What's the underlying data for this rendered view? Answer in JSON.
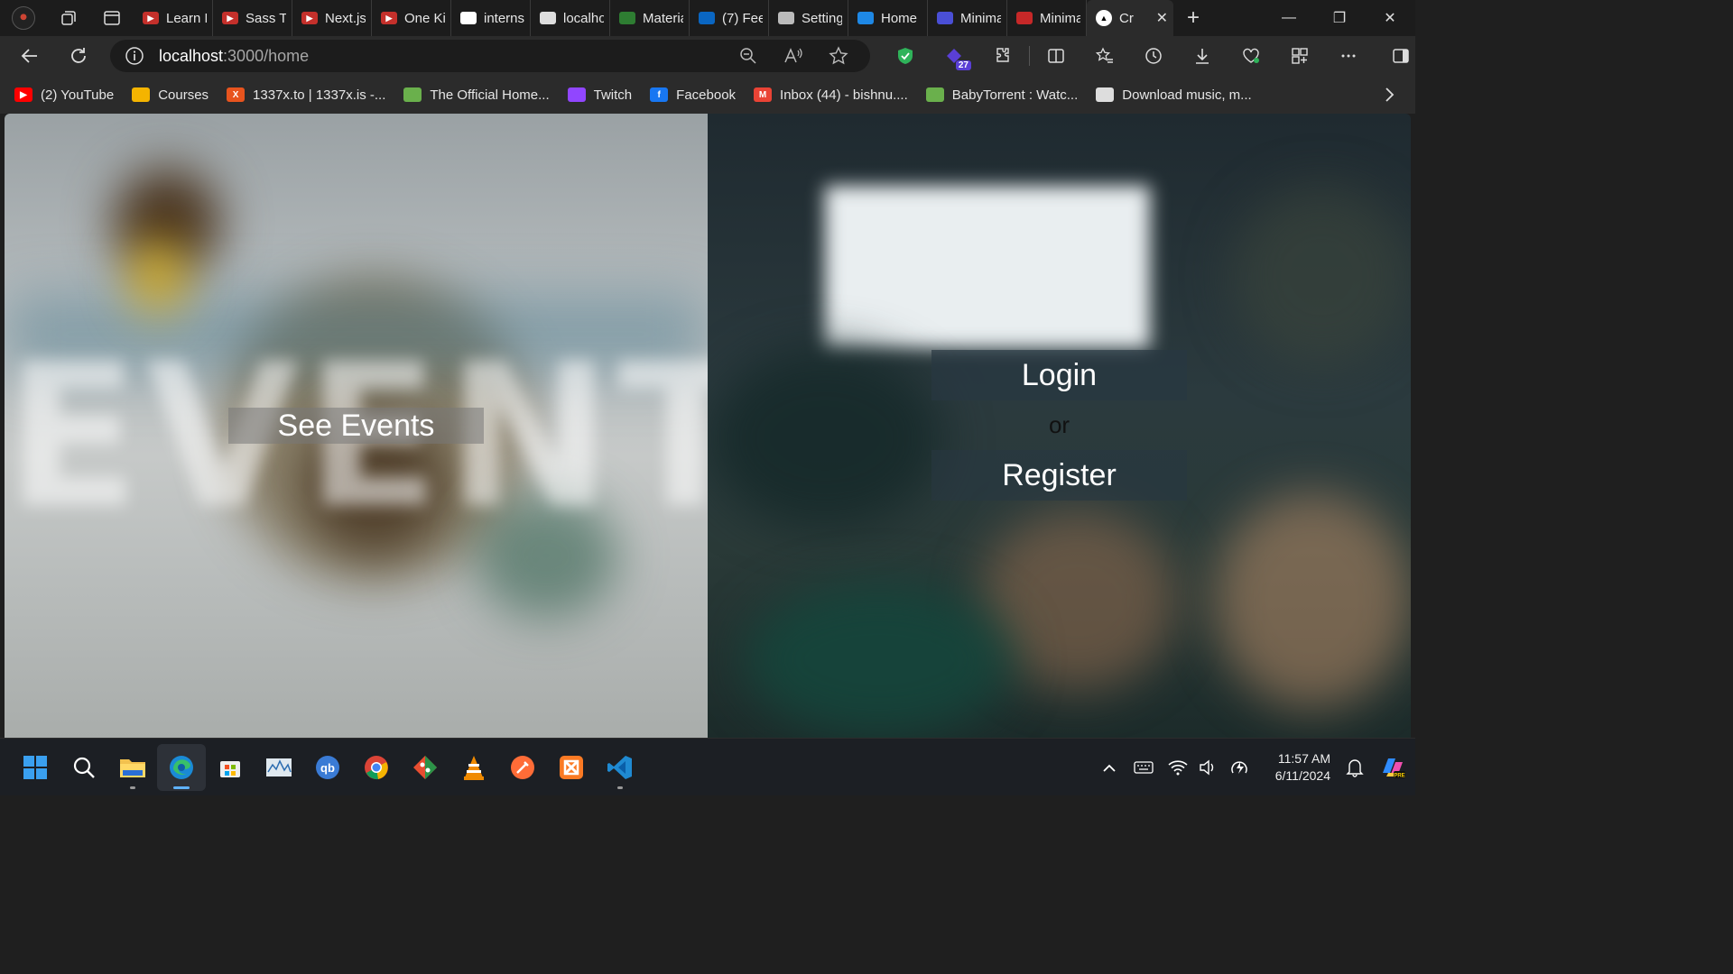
{
  "tabs": [
    {
      "label": "Learn R",
      "icon": "youtube-icon",
      "color": "#c4302b"
    },
    {
      "label": "Sass Tu",
      "icon": "youtube-icon",
      "color": "#c4302b"
    },
    {
      "label": "Next.js",
      "icon": "youtube-icon",
      "color": "#c4302b"
    },
    {
      "label": "One Ki",
      "icon": "youtube-icon",
      "color": "#c4302b"
    },
    {
      "label": "interns",
      "icon": "github-icon",
      "color": "#ffffff"
    },
    {
      "label": "localho",
      "icon": "document-icon",
      "color": "#dddddd"
    },
    {
      "label": "Materia",
      "icon": "material-icon",
      "color": "#2e7d32"
    },
    {
      "label": "(7) Fee",
      "icon": "linkedin-icon",
      "color": "#0a66c2"
    },
    {
      "label": "Setting",
      "icon": "gear-icon",
      "color": "#bbbbbb"
    },
    {
      "label": "Home",
      "icon": "c-logo-icon",
      "color": "#1e88e5"
    },
    {
      "label": "Minima",
      "icon": "app-icon",
      "color": "#4a4fd6"
    },
    {
      "label": "Minima",
      "icon": "pdf-icon",
      "color": "#c62828"
    }
  ],
  "active_tab": {
    "label": "Cr",
    "icon": "triangle-icon"
  },
  "address": {
    "host": "localhost",
    "path": ":3000/home"
  },
  "extension_badge": "27",
  "bookmarks": [
    {
      "label": "(2) YouTube",
      "icon": "youtube-icon",
      "color": "#ff0000"
    },
    {
      "label": "Courses",
      "icon": "classroom-icon",
      "color": "#f4b400"
    },
    {
      "label": "1337x.to | 1337x.is -...",
      "icon": "x-icon",
      "color": "#e8541e"
    },
    {
      "label": "The Official Home...",
      "icon": "yts-icon",
      "color": "#6ab04c"
    },
    {
      "label": "Twitch",
      "icon": "twitch-icon",
      "color": "#9146ff"
    },
    {
      "label": "Facebook",
      "icon": "facebook-icon",
      "color": "#1877f2"
    },
    {
      "label": "Inbox (44) - bishnu....",
      "icon": "gmail-icon",
      "color": "#ea4335"
    },
    {
      "label": "BabyTorrent : Watc...",
      "icon": "yts-icon",
      "color": "#6ab04c"
    },
    {
      "label": "Download music, m...",
      "icon": "monitor-icon",
      "color": "#dddddd"
    }
  ],
  "page": {
    "see_events": "See Events",
    "login": "Login",
    "or": "or",
    "register": "Register"
  },
  "taskbar": {
    "time": "11:57 AM",
    "date": "6/11/2024"
  }
}
